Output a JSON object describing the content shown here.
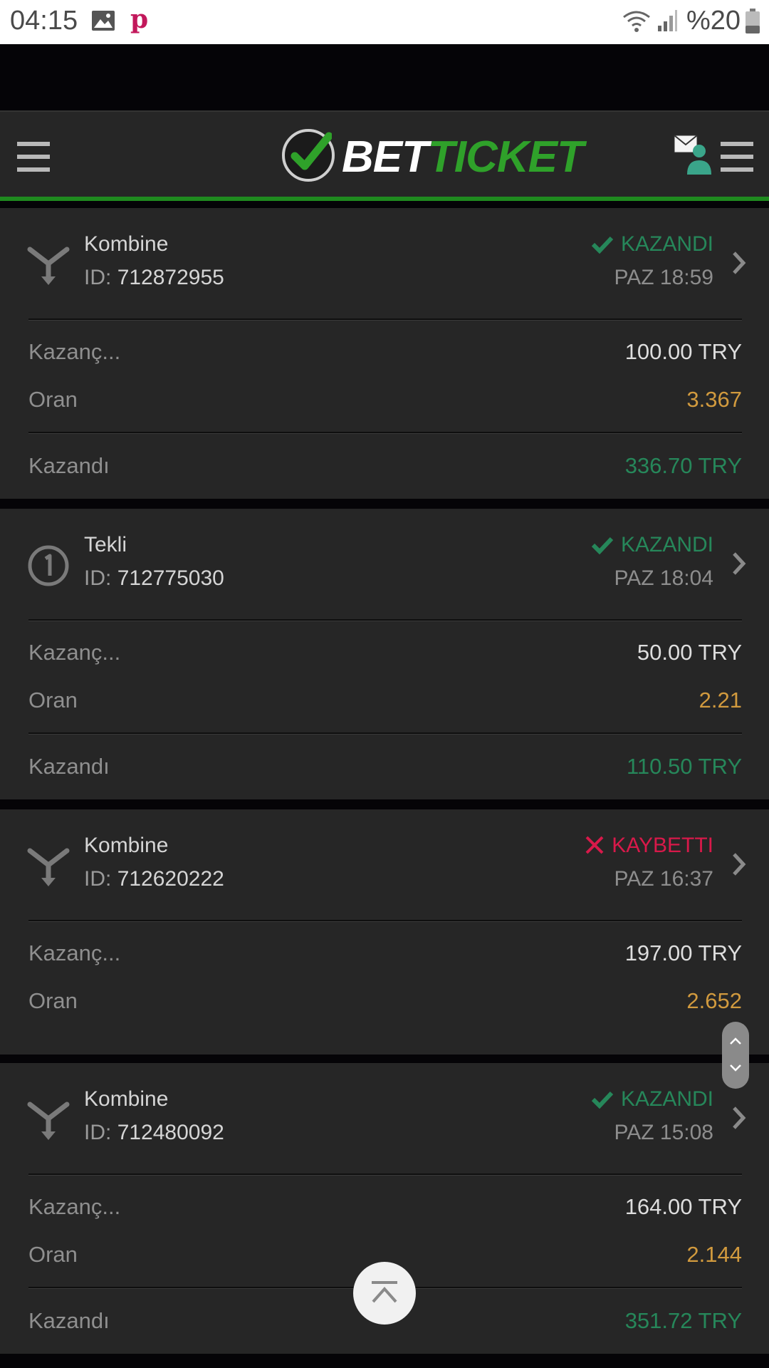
{
  "status_bar": {
    "time": "04:15",
    "battery": "%20"
  },
  "header": {
    "logo_text_white": "BET",
    "logo_text_green": "TICKET"
  },
  "labels": {
    "id_prefix": "ID:",
    "stake": "Kazanç...",
    "odds": "Oran",
    "payout": "Kazandı"
  },
  "bets": [
    {
      "type": "Kombine",
      "id": "712872955",
      "status": "KAZANDI",
      "date": "PAZ 18:59",
      "stake": "100.00 TRY",
      "odds": "3.367",
      "payout": "336.70 TRY"
    },
    {
      "type": "Tekli",
      "id": "712775030",
      "status": "KAZANDI",
      "date": "PAZ 18:04",
      "stake": "50.00 TRY",
      "odds": "2.21",
      "payout": "110.50 TRY"
    },
    {
      "type": "Kombine",
      "id": "712620222",
      "status": "KAYBETTI",
      "date": "PAZ 16:37",
      "stake": "197.00 TRY",
      "odds": "2.652"
    },
    {
      "type": "Kombine",
      "id": "712480092",
      "status": "KAZANDI",
      "date": "PAZ 15:08",
      "stake": "164.00 TRY",
      "odds": "2.144",
      "payout": "351.72 TRY"
    }
  ],
  "colors": {
    "won": "#26875a",
    "lost": "#d8194a",
    "odds": "#d19a3e",
    "brand_green": "#2fa12a"
  }
}
